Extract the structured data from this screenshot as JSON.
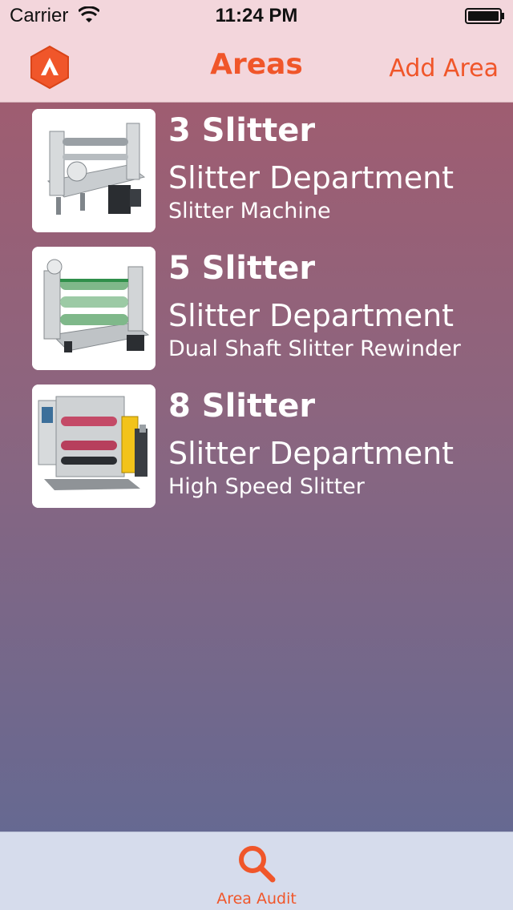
{
  "status_bar": {
    "carrier": "Carrier",
    "time": "11:24 PM"
  },
  "nav": {
    "title": "Areas",
    "add_label": "Add Area",
    "logo_icon": "app-logo-icon"
  },
  "colors": {
    "accent": "#f0562a",
    "topbar": "#f3d6dc",
    "tabbar": "#d6dcec"
  },
  "areas": [
    {
      "title": "3 Slitter",
      "department": "Slitter Department",
      "description": "Slitter Machine"
    },
    {
      "title": "5 Slitter",
      "department": "Slitter Department",
      "description": "Dual Shaft Slitter Rewinder"
    },
    {
      "title": "8 Slitter",
      "department": "Slitter Department",
      "description": "High Speed Slitter"
    }
  ],
  "tabs": [
    {
      "label": "Area Audit",
      "icon": "search-icon"
    }
  ]
}
